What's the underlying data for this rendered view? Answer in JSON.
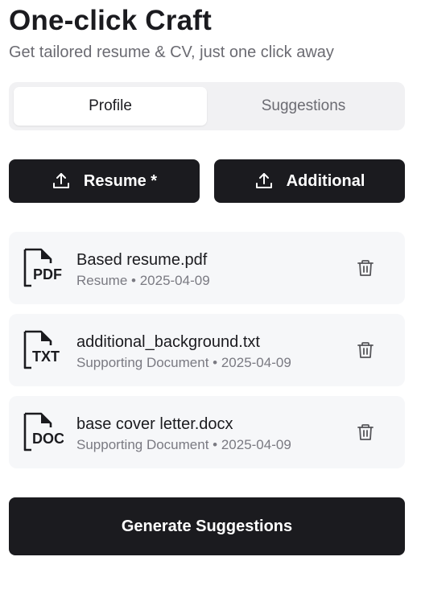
{
  "header": {
    "title": "One-click Craft",
    "subtitle": "Get tailored resume & CV, just one click away"
  },
  "tabs": [
    {
      "label": "Profile",
      "active": true
    },
    {
      "label": "Suggestions",
      "active": false
    }
  ],
  "upload_buttons": [
    {
      "label": "Resume *",
      "icon": "upload-icon"
    },
    {
      "label": "Additional",
      "icon": "upload-icon"
    }
  ],
  "files": [
    {
      "name": "Based resume.pdf",
      "meta": "Resume • 2025-04-09",
      "type_label": "PDF",
      "icon": "pdf-file-icon"
    },
    {
      "name": "additional_background.txt",
      "meta": "Supporting Document • 2025-04-09",
      "type_label": "TXT",
      "icon": "txt-file-icon"
    },
    {
      "name": "base cover letter.docx",
      "meta": "Supporting Document • 2025-04-09",
      "type_label": "DOC",
      "icon": "doc-file-icon"
    }
  ],
  "actions": {
    "generate_label": "Generate Suggestions"
  },
  "colors": {
    "primary": "#1b1b1f",
    "muted_text": "#6b6b72",
    "card_bg": "#f6f7f9",
    "tab_bg": "#f1f1f3"
  }
}
